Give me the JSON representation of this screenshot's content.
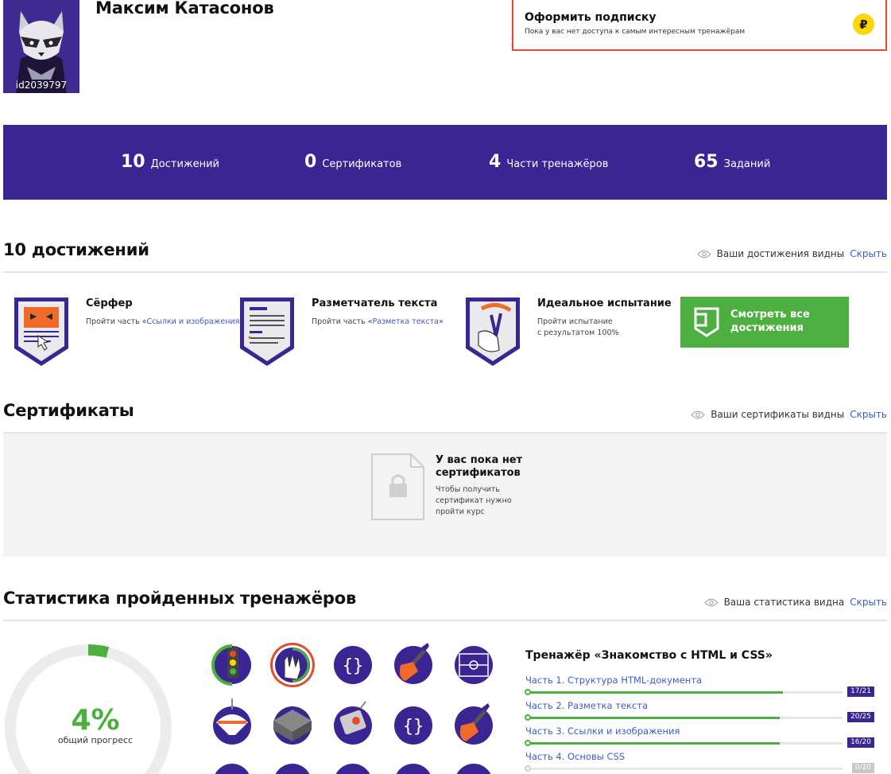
{
  "profile": {
    "name": "Максим Катасонов",
    "user_id": "id2039797"
  },
  "subscription": {
    "title": "Оформить подписку",
    "description": "Пока у вас нет доступа к самым интересным тренажёрам",
    "icon": "ruble-icon",
    "icon_glyph": "₽",
    "border_color": "#e44b2a",
    "icon_color": "#ffd60a"
  },
  "stats": [
    {
      "value": "10",
      "label": "Достижений"
    },
    {
      "value": "0",
      "label": "Сертификатов"
    },
    {
      "value": "4",
      "label": "Части тренажёров"
    },
    {
      "value": "65",
      "label": "Заданий"
    }
  ],
  "achievements": {
    "title": "10 достижений",
    "visibility": "Ваши достижения видны",
    "hide_label": "Скрыть",
    "items": [
      {
        "title": "Сёрфер",
        "desc_prefix": "Пройти часть «",
        "desc_link": "Ссылки и изображения",
        "desc_suffix": "»",
        "icon": "surfer-badge-icon"
      },
      {
        "title": "Разметчатель текста",
        "desc_prefix": "Пройти часть «",
        "desc_link": "Разметка текста",
        "desc_suffix": "»",
        "icon": "text-markup-badge-icon"
      },
      {
        "title": "Идеальное испытание",
        "desc_line1": "Пройти испытание",
        "desc_line2": "с результатом 100%",
        "icon": "slingshot-badge-icon"
      }
    ],
    "view_all_label_1": "Смотреть все",
    "view_all_label_2": "достижения"
  },
  "certificates": {
    "title": "Сертификаты",
    "visibility": "Ваши сертификаты видны",
    "hide_label": "Скрыть",
    "empty_title_1": "У вас пока нет",
    "empty_title_2": "сертификатов",
    "empty_desc_1": "Чтобы получить",
    "empty_desc_2": "сертификат нужно",
    "empty_desc_3": "пройти курс"
  },
  "trainer_stats": {
    "title": "Статистика пройденных тренажёров",
    "visibility": "Ваша статистика видна",
    "hide_label": "Скрыть",
    "overall_progress": "4%",
    "overall_progress_fraction": 0.04,
    "overall_caption": "общий прогресс",
    "icons": [
      "traffic-light-icon",
      "spock-hand-icon",
      "curly-braces-icon",
      "paint-brush-icon",
      "soccer-field-icon",
      "spinning-top-icon",
      "lego-brick-icon",
      "robot-icon",
      "curly-braces-icon",
      "paint-brush-icon"
    ],
    "trainer_title": "Тренажёр «Знакомство с HTML и CSS»",
    "parts": [
      {
        "label": "Часть 1. Структура HTML-документа",
        "count": "17/21",
        "progress": 0.81
      },
      {
        "label": "Часть 2. Разметка текста",
        "count": "20/25",
        "progress": 0.8
      },
      {
        "label": "Часть 3. Ссылки и изображения",
        "count": "16/20",
        "progress": 0.8
      },
      {
        "label": "Часть 4. Основы CSS",
        "count": "0/20",
        "progress": 0
      }
    ]
  },
  "colors": {
    "brand_purple": "#3b2593",
    "green": "#4caf3f",
    "link_blue": "#3b5bd6"
  }
}
